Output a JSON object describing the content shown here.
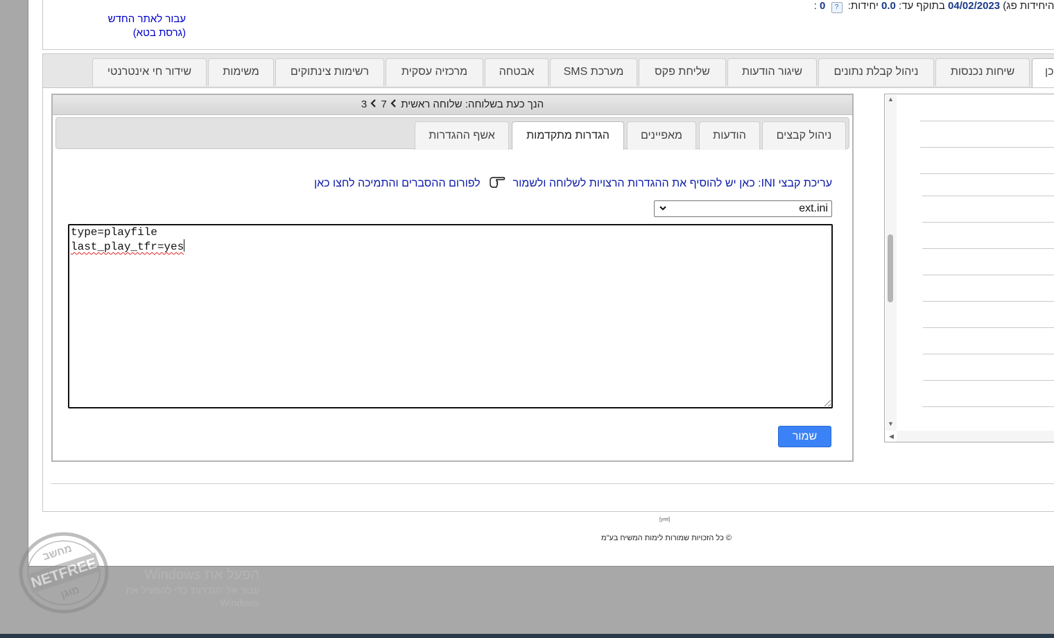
{
  "header": {
    "units_line": {
      "balance_value": "0",
      "help_icon": "question-icon",
      "units_label": "יחידות:",
      "units_value": "0.0",
      "valid_label": "בתוקף עד:",
      "valid_date": "04/02/2023",
      "expiry_note": "(תוקף היחידות פג)"
    },
    "beta_link": {
      "line1": "עבור לאתר החדש",
      "line2": "(גרסת בטא)"
    }
  },
  "top_tabs": [
    {
      "label": "מכן"
    },
    {
      "label": "שיחות נכנסות"
    },
    {
      "label": "ניהול קבלת נתונים"
    },
    {
      "label": "שיגור הודעות"
    },
    {
      "label": "שליחת פקס"
    },
    {
      "label": "מערכת SMS"
    },
    {
      "label": "אבטחה"
    },
    {
      "label": "מרכזיה עסקית"
    },
    {
      "label": "רשימות צינתוקים"
    },
    {
      "label": "משימות"
    },
    {
      "label": "שידור חי אינטרנטי"
    }
  ],
  "extension_panel": {
    "title": "הנך כעת בשלוחה: שלוחה ראשית",
    "path_1": "7",
    "path_2": "3",
    "path_separator_icon": "chevron-right-icon",
    "sub_tabs": [
      {
        "label": "ניהול קבצים"
      },
      {
        "label": "הודעות"
      },
      {
        "label": "מאפיינים"
      },
      {
        "label": "הגדרות מתקדמות",
        "active": true
      },
      {
        "label": "אשף ההגדרות"
      }
    ],
    "info_text": "עריכת קבצי INI: כאן יש להוסיף את ההגדרות הרצויות לשלוחה ולשמור",
    "hand_icon": "pointing-hand-icon",
    "forum_link": "לפורום ההסברים והתמיכה לחצו כאן",
    "file_select": {
      "value": "ext.ini",
      "icon": "chevron-down-icon"
    },
    "editor": {
      "line1": "type=playfile",
      "line2": "last_play_tfr=yes"
    },
    "save_label": "שמור"
  },
  "footer": {
    "ymt": "[ymt]",
    "copyright": "© כל הזכויות שמורות לימות המשיח בע\"מ"
  },
  "watermarks": {
    "windows_line1": "הפעל את Windows",
    "windows_line2": "עבור אל 'הגדרות' כדי להפעיל את Windows",
    "stamp_top": "מחשב",
    "stamp_mid": "NETFREE",
    "stamp_bottom": "מוגן"
  },
  "colors": {
    "link_blue": "#0000cc",
    "save_button": "#3b82f6",
    "value_blue": "#1a3a8a"
  }
}
